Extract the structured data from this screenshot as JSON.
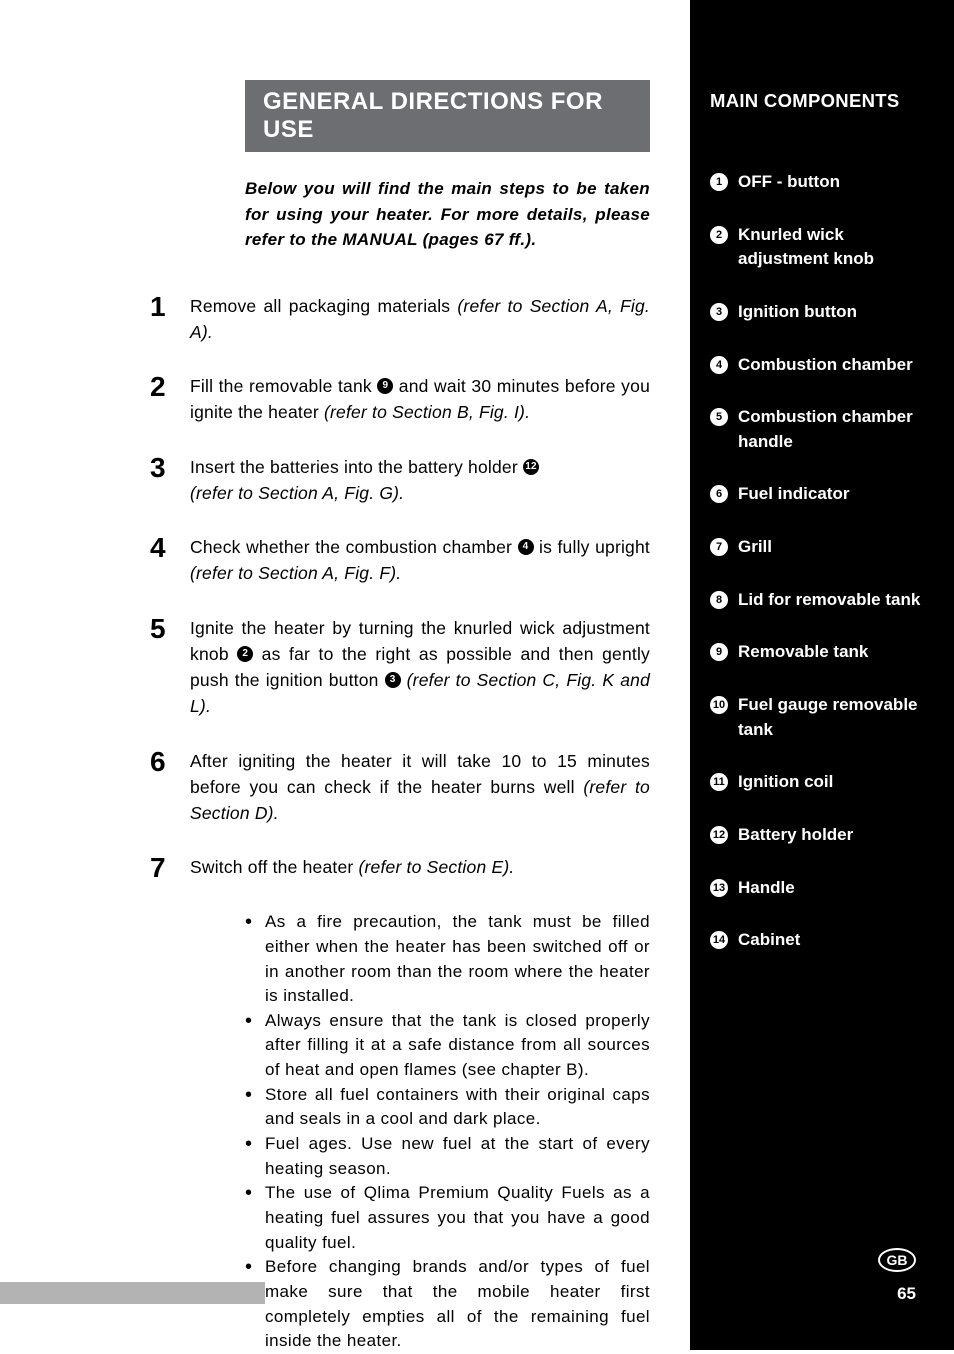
{
  "title": "GENERAL DIRECTIONS FOR USE",
  "intro": "Below you will find the main steps to be taken for using your heater. For more details, please refer to the MANUAL (pages 67 ff.).",
  "steps": [
    {
      "num": "1",
      "text_plain": "Remove all packaging materials ",
      "ital": "(refer to Section A, Fig. A)."
    },
    {
      "num": "2",
      "pre": "Fill the removable tank ",
      "circ": "9",
      "post": " and wait 30 minutes before you ignite the heater ",
      "ital": "(refer to Section B, Fig. I)."
    },
    {
      "num": "3",
      "pre": "Insert the batteries into the battery holder ",
      "circ": "12",
      "post_br": "",
      "ital": "(refer to Section A, Fig. G)."
    },
    {
      "num": "4",
      "pre": "Check whether the combustion chamber ",
      "circ": "4",
      "post": " is fully upright ",
      "ital": "(refer to Section A, Fig. F)."
    },
    {
      "num": "5",
      "pre": "Ignite the heater by turning the knurled wick adjustment knob ",
      "circ": "2",
      "mid": " as far to the right as possible and then gently push the ignition button ",
      "circ2": "3",
      "post": " ",
      "ital": "(refer to Section C, Fig. K and L)."
    },
    {
      "num": "6",
      "text_plain": "After igniting the heater it will take 10 to 15 minutes before you can check if the heater burns well ",
      "ital": "(refer to Section D)."
    },
    {
      "num": "7",
      "text_plain": "Switch off the heater ",
      "ital": "(refer to Section E)."
    }
  ],
  "precautions": [
    "As a fire precaution, the tank must be filled either when the heater has been switched off or in another room than the room where the heater is installed.",
    "Always ensure that the tank is closed properly after filling it at a safe distance from all sources of heat and open flames (see chapter B).",
    "Store all fuel containers with their original caps and seals in a cool and dark place.",
    "Fuel ages. Use new fuel at the start of every heating season.",
    "The use of Qlima Premium Quality Fuels as a heating fuel assures you that you have a good quality fuel.",
    "Before changing brands and/or types of fuel make sure that the mobile heater first  completely empties all of the remaining fuel inside the heater."
  ],
  "sidebar": {
    "title": "MAIN COMPONENTS",
    "items": [
      {
        "n": "1",
        "label": "OFF - button"
      },
      {
        "n": "2",
        "label": "Knurled wick adjustment knob"
      },
      {
        "n": "3",
        "label": "Ignition button"
      },
      {
        "n": "4",
        "label": "Combustion chamber"
      },
      {
        "n": "5",
        "label": "Combustion chamber handle"
      },
      {
        "n": "6",
        "label": "Fuel indicator"
      },
      {
        "n": "7",
        "label": "Grill"
      },
      {
        "n": "8",
        "label": "Lid for removable tank"
      },
      {
        "n": "9",
        "label": "Removable tank"
      },
      {
        "n": "10",
        "label": "Fuel gauge removable tank"
      },
      {
        "n": "11",
        "label": "Ignition coil"
      },
      {
        "n": "12",
        "label": "Battery holder"
      },
      {
        "n": "13",
        "label": "Handle"
      },
      {
        "n": "14",
        "label": "Cabinet"
      }
    ]
  },
  "lang": "GB",
  "page_num": "65",
  "bullet": "•"
}
